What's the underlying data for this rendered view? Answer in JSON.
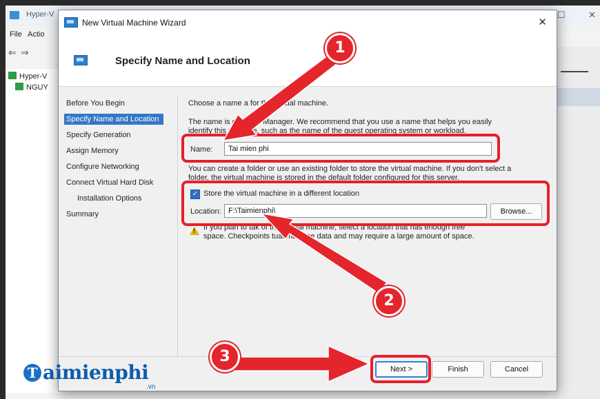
{
  "background_window": {
    "title": "Hyper-V",
    "menu": [
      "File",
      "Actio"
    ],
    "tree": [
      "Hyper-V",
      "NGUY"
    ]
  },
  "dialog": {
    "title": "New Virtual Machine Wizard",
    "close_glyph": "✕",
    "header_title": "Specify Name and Location",
    "nav": [
      "Before You Begin",
      "Specify Name and Location",
      "Specify Generation",
      "Assign Memory",
      "Configure Networking",
      "Connect Virtual Hard Disk",
      "Installation Options",
      "Summary"
    ],
    "intro": "Choose a name a                  for this virtual machine.",
    "recommend_line1": "The name is d            yper-V Manager. We recommend that you use a name that helps you easily",
    "recommend_line2": "identify this          machine, such as the name of the guest operating system or workload.",
    "name_label": "Name:",
    "name_value": "Tai mien phi",
    "folder_line1": "You can create a folder or use an existing folder to store the virtual machine. If you don't select a",
    "folder_line2": "folder, the virtual machine is stored in the default folder configured for this server.",
    "store_checkbox_label": "Store the virtual machine in a different location",
    "store_checked": true,
    "location_label": "Location:",
    "location_value": "F:\\Taimienphi\\",
    "browse_label": "Browse...",
    "warning_line1": "If you plan to tak                  of this virtual machine, select a location that has enough free",
    "warning_line2": "space. Checkpoints           tual machine data and may require a large amount of space.",
    "buttons": {
      "next": "Next >",
      "finish": "Finish",
      "cancel": "Cancel"
    }
  },
  "annotations": {
    "badge1": "1",
    "badge2": "2",
    "badge3": "3",
    "color": "#e4252c"
  },
  "watermark": {
    "logo_letter": "T",
    "text": "aimienphi",
    "suffix": ".vn"
  }
}
